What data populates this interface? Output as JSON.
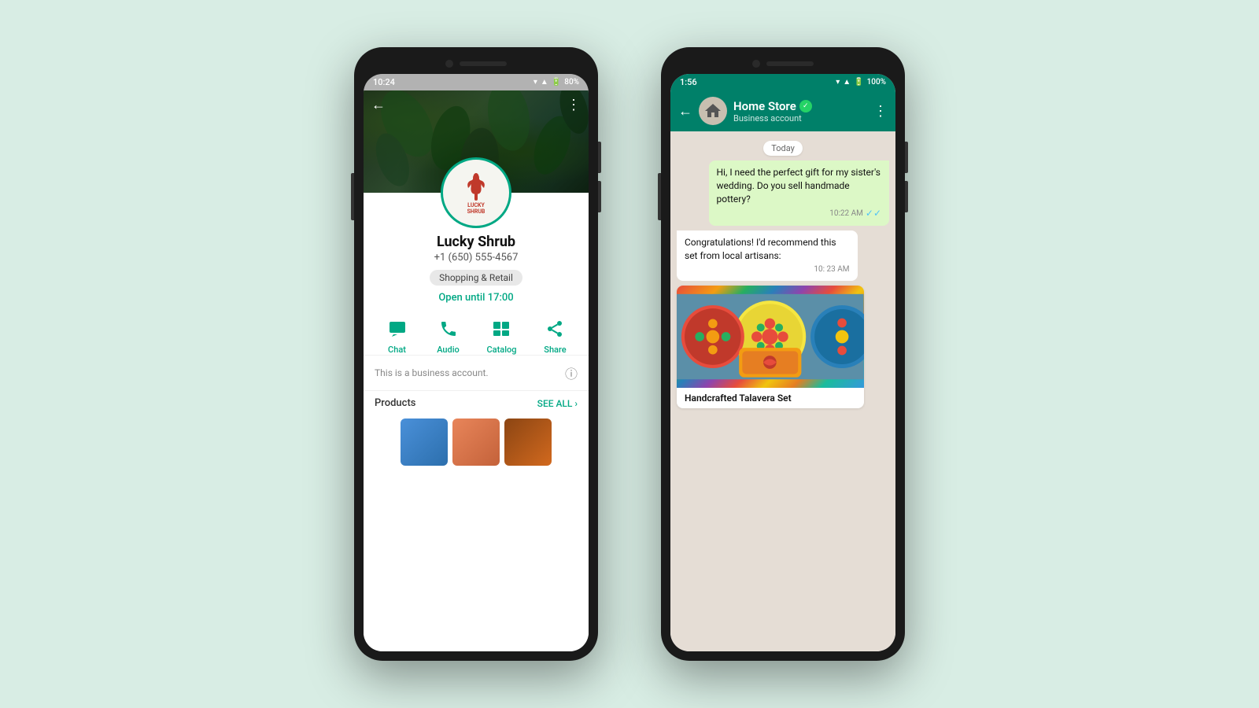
{
  "background_color": "#d8ede4",
  "left_phone": {
    "status_bar": {
      "time": "10:24",
      "wifi": true,
      "signal": true,
      "battery": "80%"
    },
    "header": {
      "back_label": "←",
      "menu_label": "⋮"
    },
    "profile": {
      "name": "Lucky Shrub",
      "phone": "+1 (650) 555-4567",
      "category": "Shopping & Retail",
      "hours": "Open until 17:00",
      "logo_top": "🌿",
      "logo_text_line1": "LUCKY",
      "logo_text_line2": "SHRUB"
    },
    "actions": [
      {
        "id": "chat",
        "label": "Chat",
        "icon": "chat"
      },
      {
        "id": "audio",
        "label": "Audio",
        "icon": "phone"
      },
      {
        "id": "catalog",
        "label": "Catalog",
        "icon": "catalog"
      },
      {
        "id": "share",
        "label": "Share",
        "icon": "share"
      }
    ],
    "business_info": "This is a business account.",
    "products": {
      "label": "Products",
      "see_all": "SEE ALL ›"
    }
  },
  "right_phone": {
    "status_bar": {
      "time": "1:56",
      "wifi": true,
      "signal": true,
      "battery": "100%"
    },
    "header": {
      "back_label": "←",
      "name": "Home Store",
      "subtitle": "Business account",
      "verified": true,
      "menu_label": "⋮"
    },
    "chat": {
      "date_divider": "Today",
      "messages": [
        {
          "id": "msg1",
          "type": "sent",
          "text": "Hi, I need the perfect gift for my sister's wedding. Do you sell handmade pottery?",
          "time": "10:22 AM",
          "read": true
        },
        {
          "id": "msg2",
          "type": "received",
          "text": "Congratulations! I'd recommend this set from local artisans:",
          "time": "10: 23 AM"
        },
        {
          "id": "msg3",
          "type": "media",
          "title": "Handcrafted Talavera Set"
        }
      ]
    }
  }
}
